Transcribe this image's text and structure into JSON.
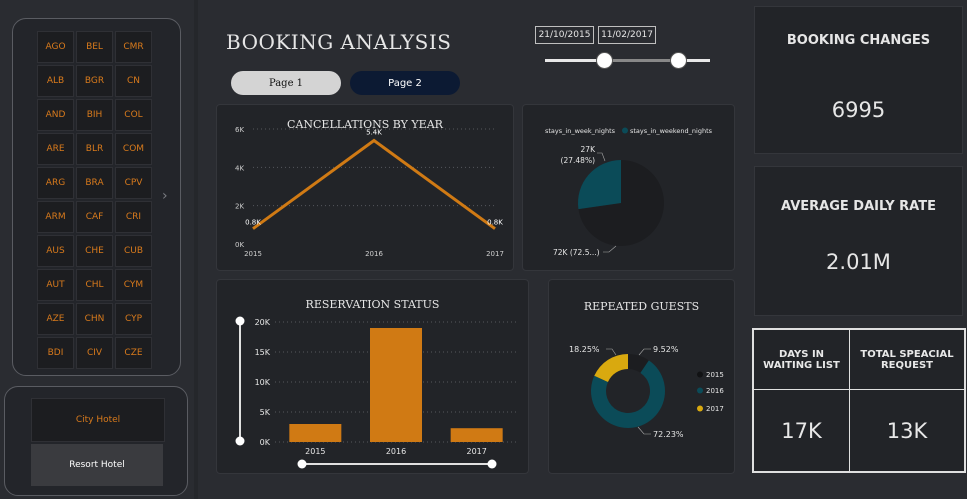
{
  "countries": [
    "AGO",
    "BEL",
    "CMR",
    "ALB",
    "BGR",
    "CN",
    "AND",
    "BIH",
    "COL",
    "ARE",
    "BLR",
    "COM",
    "ARG",
    "BRA",
    "CPV",
    "ARM",
    "CAF",
    "CRI",
    "AUS",
    "CHE",
    "CUB",
    "AUT",
    "CHL",
    "CYM",
    "AZE",
    "CHN",
    "CYP",
    "BDI",
    "CIV",
    "CZE"
  ],
  "hotels": [
    "City Hotel",
    "Resort Hotel"
  ],
  "title": "BOOKING ANALYSIS",
  "pages": [
    "Page 1",
    "Page 2"
  ],
  "dates": {
    "start": "21/10/2015",
    "end": "11/02/2017"
  },
  "kpis": {
    "booking_changes": {
      "label": "BOOKING CHANGES",
      "value": "6995"
    },
    "adr": {
      "label": "AVERAGE DAILY RATE",
      "value": "2.01M"
    },
    "waiting": {
      "label": "DAYS IN WAITING LIST",
      "value": "17K"
    },
    "special": {
      "label": "TOTAL SPEACIAL REQUEST",
      "value": "13K"
    }
  },
  "colors": {
    "orange": "#d07a14",
    "teal": "#0b4b58",
    "gold": "#d9a90f",
    "dark": "#1c1d20"
  },
  "chart_data": [
    {
      "type": "line",
      "title": "CANCELLATIONS BY YEAR",
      "categories": [
        "2015",
        "2016",
        "2017"
      ],
      "values": [
        0.8,
        5.4,
        0.8
      ],
      "data_labels": [
        "0.8K",
        "5.4K",
        "0.8K"
      ],
      "y_ticks": [
        "0K",
        "2K",
        "4K",
        "6K"
      ],
      "ylim": [
        0,
        6
      ],
      "grid": true
    },
    {
      "type": "pie",
      "legend": [
        "stays_in_week_nights",
        "stays_in_weekend_nights"
      ],
      "values": [
        72,
        27
      ],
      "data_labels": [
        "72K (72.5...)",
        "27K\n(27.48%)"
      ]
    },
    {
      "type": "bar",
      "title": "RESERVATION STATUS",
      "categories": [
        "2015",
        "2016",
        "2017"
      ],
      "values": [
        3000,
        19000,
        2300
      ],
      "y_ticks": [
        "0K",
        "5K",
        "10K",
        "15K",
        "20K"
      ],
      "ylim": [
        0,
        20000
      ],
      "grid": true
    },
    {
      "type": "pie",
      "title": "REPEATED GUESTS",
      "legend": [
        "2015",
        "2016",
        "2017"
      ],
      "values": [
        9.52,
        72.23,
        18.25
      ],
      "data_labels": [
        "9.52%",
        "72.23%",
        "18.25%"
      ],
      "legend_position": "right"
    }
  ]
}
